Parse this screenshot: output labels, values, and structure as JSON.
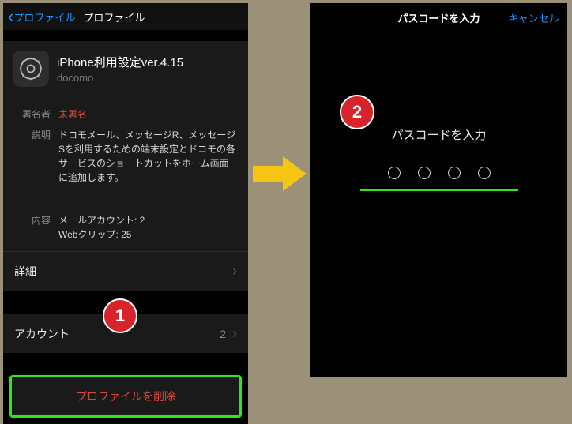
{
  "phone1": {
    "nav": {
      "back": "プロファイル",
      "title": "プロファイル"
    },
    "profile": {
      "title": "iPhone利用設定ver.4.15",
      "org": "docomo"
    },
    "meta": {
      "signer_label": "署名者",
      "signer_value": "未署名",
      "desc_label": "説明",
      "desc_value": "ドコモメール、メッセージR、メッセージSを利用するための端末設定とドコモの各サービスのショートカットをホーム画面に追加します。",
      "content_label": "内容",
      "content_line1": "メールアカウント: 2",
      "content_line2": "Webクリップ: 25"
    },
    "detail_row": "詳細",
    "account_row": {
      "label": "アカウント",
      "count": "2"
    },
    "delete_label": "プロファイルを削除"
  },
  "phone2": {
    "nav": {
      "title": "パスコードを入力",
      "cancel": "キャンセル"
    },
    "prompt": "パスコードを入力"
  },
  "badges": {
    "b1": "1",
    "b2": "2"
  }
}
